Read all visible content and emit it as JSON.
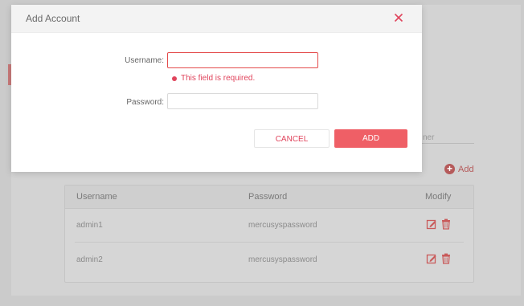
{
  "background": {
    "field_hint_text": "ner",
    "add_link_label": "Add",
    "add_icon": "plus-circle-icon",
    "table": {
      "headers": [
        "Username",
        "Password",
        "Modify"
      ],
      "rows": [
        {
          "username": "admin1",
          "password": "mercusyspassword"
        },
        {
          "username": "admin2",
          "password": "mercusyspassword"
        }
      ],
      "edit_icon": "edit-icon",
      "delete_icon": "trash-icon"
    }
  },
  "modal": {
    "title": "Add Account",
    "close_icon": "close-icon",
    "username_label": "Username:",
    "username_value": "",
    "username_error": "This field is required.",
    "password_label": "Password:",
    "password_value": "",
    "cancel_label": "CANCEL",
    "add_label": "ADD"
  },
  "colors": {
    "accent": "#e0445c",
    "add_button": "#ef5f66",
    "overlay": "#cbcbcb"
  }
}
